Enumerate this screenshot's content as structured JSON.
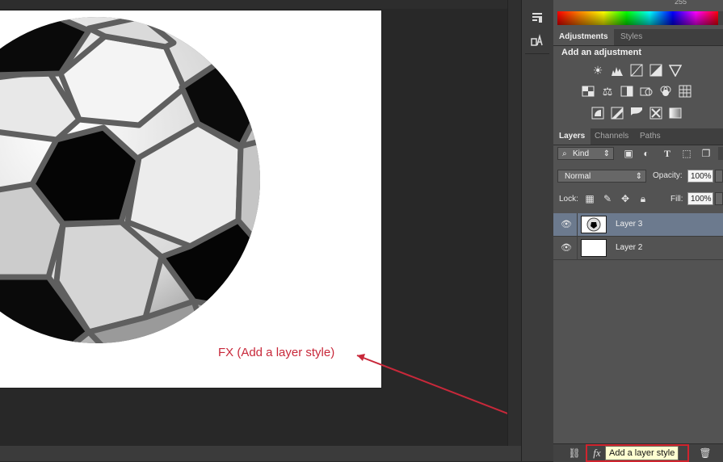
{
  "canvas": {
    "annotation": "FX (Add a layer style)",
    "annotation_color": "#c8283a"
  },
  "toolstrip": {
    "icons": [
      "paragraph-tool-icon",
      "character-tool-icon"
    ]
  },
  "color": {
    "value": "255"
  },
  "adjustments": {
    "tabs": [
      "Adjustments",
      "Styles"
    ],
    "title": "Add an adjustment",
    "icons": [
      "brightness-icon",
      "levels-icon",
      "curves-icon",
      "exposure-icon",
      "vibrance-icon",
      "hue-saturation-icon",
      "color-balance-icon",
      "black-white-icon",
      "photo-filter-icon",
      "channel-mixer-icon",
      "color-lookup-icon",
      "invert-icon",
      "posterize-icon",
      "threshold-icon",
      "selective-color-icon",
      "gradient-map-icon"
    ]
  },
  "layers": {
    "tabs": [
      "Layers",
      "Channels",
      "Paths"
    ],
    "filter_kind": "Kind",
    "blend_mode": "Normal",
    "opacity_label": "Opacity:",
    "opacity_value": "100%",
    "lock_label": "Lock:",
    "fill_label": "Fill:",
    "fill_value": "100%",
    "items": [
      {
        "name": "Layer 3",
        "selected": true
      },
      {
        "name": "Layer 2",
        "selected": false
      }
    ],
    "tooltip": "Add a layer style",
    "fx_label": "fx",
    "highlight_color": "#d0242e",
    "selected_color": "#6c7a8e"
  }
}
